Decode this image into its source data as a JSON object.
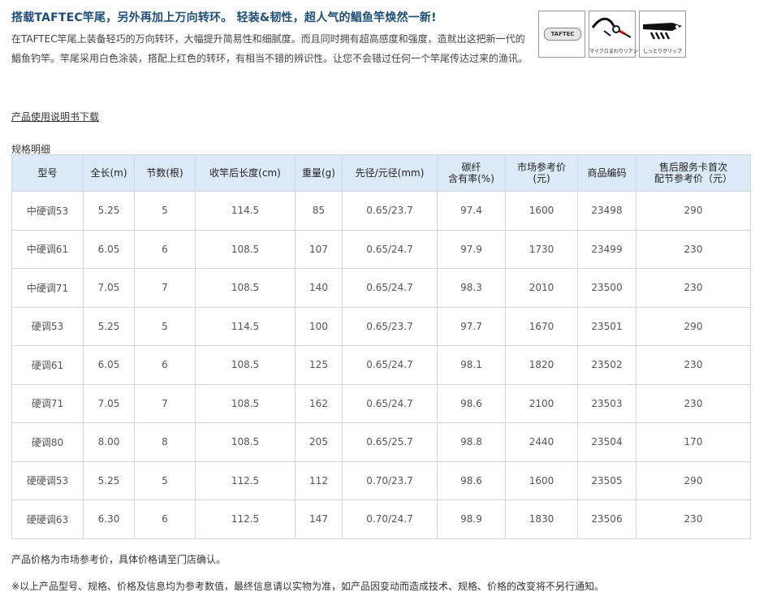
{
  "heading": "搭载TAFTEC竿尾，另外再加上万向转环。 轻装&韧性，超人气的鲳鱼竿焕然一新!",
  "description": "在TAFTEC竿尾上装备轻巧的万向转环，大幅提升简易性和细腻度。而且同时拥有超高感度和强度，造就出这把新一代的鲳鱼钓竿。竿尾采用白色涂装，搭配上红色的转环，有相当不错的辨识性。让您不会错过任何一个竿尾传达过来的渔讯。",
  "icons": [
    {
      "name": "taftec-logo-icon",
      "text": "TAFTEC",
      "caption": ""
    },
    {
      "name": "micro-swivel-icon",
      "text": "",
      "caption": "マイクロまわりリアン"
    },
    {
      "name": "grip-icon",
      "text": "",
      "caption": "しっとりグリップ"
    }
  ],
  "download_link": "产品使用说明书下载",
  "spec_title": "规格明细",
  "table": {
    "headers": [
      "型号",
      "全长(m)",
      "节数(根)",
      "收竿后长度(cm)",
      "重量(g)",
      "先径/元径(mm)",
      "碳纤\n含有率(%)",
      "市场参考价\n(元)",
      "商品编码",
      "售后服务卡首次\n配节参考价（元）"
    ],
    "rows": [
      [
        "中硬调53",
        "5.25",
        "5",
        "114.5",
        "85",
        "0.65/23.7",
        "97.4",
        "1600",
        "23498",
        "290"
      ],
      [
        "中硬调61",
        "6.05",
        "6",
        "108.5",
        "107",
        "0.65/24.7",
        "97.9",
        "1730",
        "23499",
        "230"
      ],
      [
        "中硬调71",
        "7.05",
        "7",
        "108.5",
        "140",
        "0.65/24.7",
        "98.3",
        "2010",
        "23500",
        "230"
      ],
      [
        "硬调53",
        "5.25",
        "5",
        "114.5",
        "100",
        "0.65/23.7",
        "97.7",
        "1670",
        "23501",
        "290"
      ],
      [
        "硬调61",
        "6.05",
        "6",
        "108.5",
        "125",
        "0.65/24.7",
        "98.1",
        "1820",
        "23502",
        "230"
      ],
      [
        "硬调71",
        "7.05",
        "7",
        "108.5",
        "162",
        "0.65/24.7",
        "98.6",
        "2100",
        "23503",
        "230"
      ],
      [
        "硬调80",
        "8.00",
        "8",
        "108.5",
        "205",
        "0.65/25.7",
        "98.8",
        "2440",
        "23504",
        "170"
      ],
      [
        "硬硬调53",
        "5.25",
        "5",
        "112.5",
        "112",
        "0.70/23.7",
        "98.6",
        "1600",
        "23505",
        "290"
      ],
      [
        "硬硬调63",
        "6.30",
        "6",
        "112.5",
        "147",
        "0.70/24.7",
        "98.9",
        "1830",
        "23506",
        "230"
      ]
    ]
  },
  "note_price": "产品价格为市场参考价，具体价格请至门店确认。",
  "note_disclaimer": "※以上产品型号、规格、价格及信息均为参考数值，最终信息请以实物为准，如产品因变动而造成技术、规格、价格的改变将不另行通知。"
}
